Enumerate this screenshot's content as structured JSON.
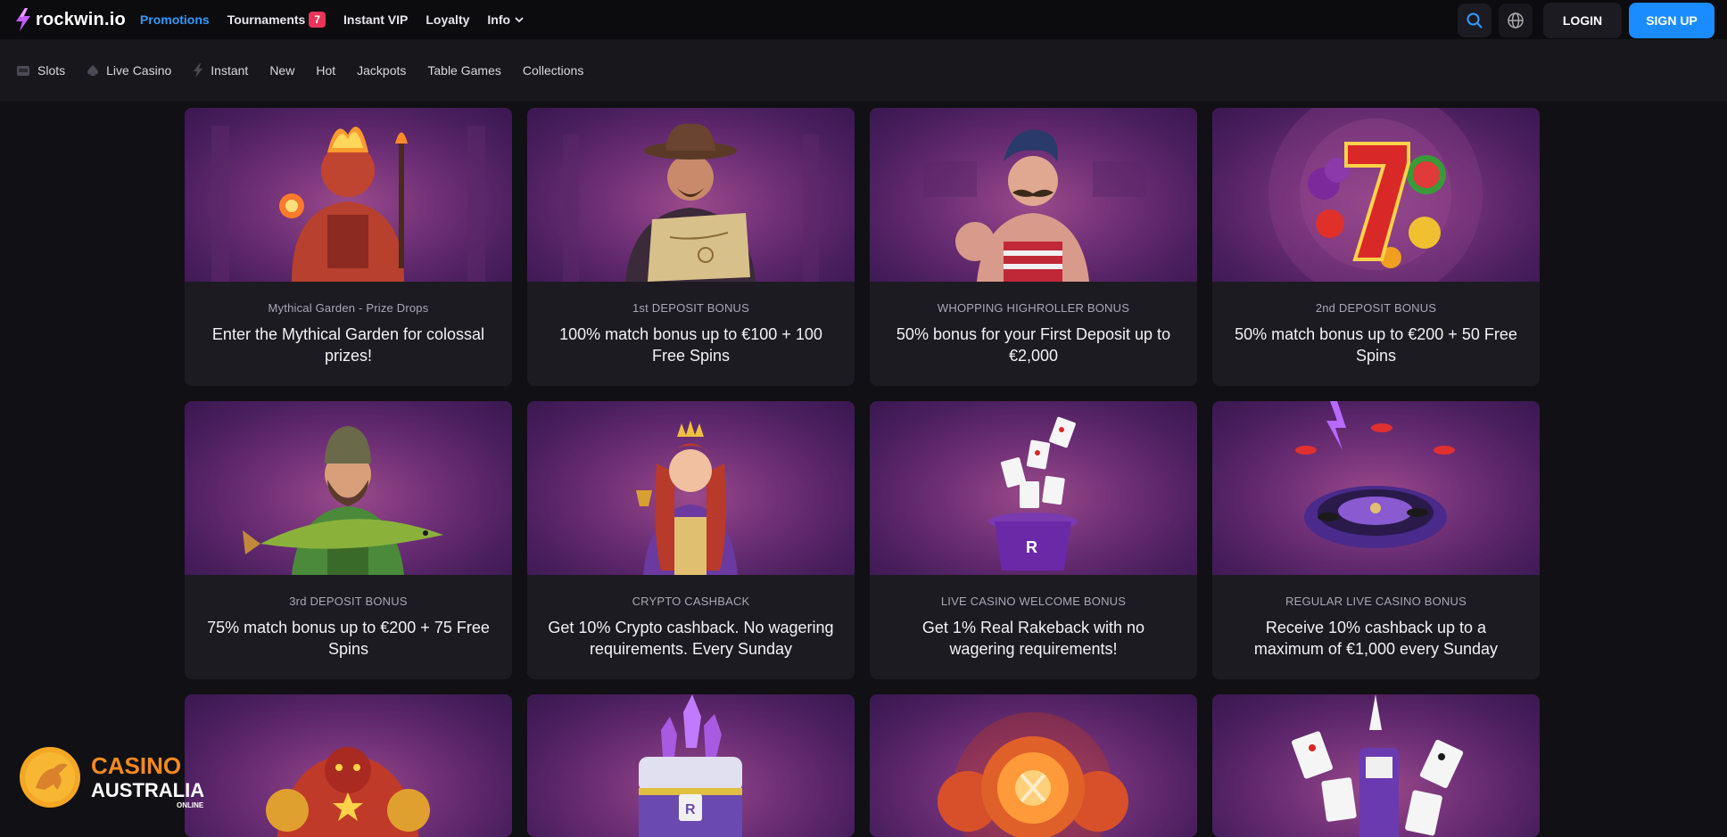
{
  "brand": {
    "name": "rockwin.io"
  },
  "topnav": {
    "items": [
      {
        "label": "Promotions"
      },
      {
        "label": "Tournaments",
        "badge": "7"
      },
      {
        "label": "Instant VIP"
      },
      {
        "label": "Loyalty"
      },
      {
        "label": "Info"
      }
    ],
    "login_label": "LOGIN",
    "signup_label": "SIGN UP"
  },
  "categories": [
    {
      "label": "Slots",
      "icon": "slot-machine-icon"
    },
    {
      "label": "Live Casino",
      "icon": "spade-icon"
    },
    {
      "label": "Instant",
      "icon": "lightning-icon"
    },
    {
      "label": "New"
    },
    {
      "label": "Hot"
    },
    {
      "label": "Jackpots"
    },
    {
      "label": "Table Games"
    },
    {
      "label": "Collections"
    }
  ],
  "promotions": [
    {
      "subtitle": "Mythical Garden - Prize Drops",
      "title": "Enter the Mythical Garden for colossal prizes!",
      "image": "fire-demon-character"
    },
    {
      "subtitle": "1st DEPOSIT BONUS",
      "title": "100% match bonus up to €100 + 100 Free Spins",
      "image": "cowboy-with-map"
    },
    {
      "subtitle": "WHOPPING HIGHROLLER BONUS",
      "title": "50% bonus for your First Deposit up to €2,000",
      "image": "strongman-mustache"
    },
    {
      "subtitle": "2nd DEPOSIT BONUS",
      "title": "50% match bonus up to €200 + 50 Free Spins",
      "image": "lucky-seven-fruits"
    },
    {
      "subtitle": "3rd DEPOSIT BONUS",
      "title": "75% match bonus up to €200 + 75 Free Spins",
      "image": "fisherman-with-fish"
    },
    {
      "subtitle": "CRYPTO CASHBACK",
      "title": "Get 10% Crypto cashback. No wagering requirements. Every Sunday",
      "image": "queen-with-goblet"
    },
    {
      "subtitle": "LIVE CASINO WELCOME BONUS",
      "title": "Get 1% Real Rakeback with no wagering requirements!",
      "image": "magic-hat-cards"
    },
    {
      "subtitle": "REGULAR LIVE CASINO BONUS",
      "title": "Receive 10% cashback up to a maximum of €1,000 every Sunday",
      "image": "roulette-wheel-chips"
    }
  ],
  "partial_cards": [
    {
      "image": "red-armored-golem"
    },
    {
      "image": "treasure-chest-crystals"
    },
    {
      "image": "fire-orb"
    },
    {
      "image": "playing-cards-deck"
    }
  ],
  "watermark": {
    "line1": "CASINO",
    "line2": "AUSTRALIA",
    "line3": "ONLINE"
  },
  "colors": {
    "accent": "#2f9bff",
    "signup": "#1a8cff",
    "badge": "#e8345a",
    "background": "#111014",
    "card": "#1c1b21"
  }
}
